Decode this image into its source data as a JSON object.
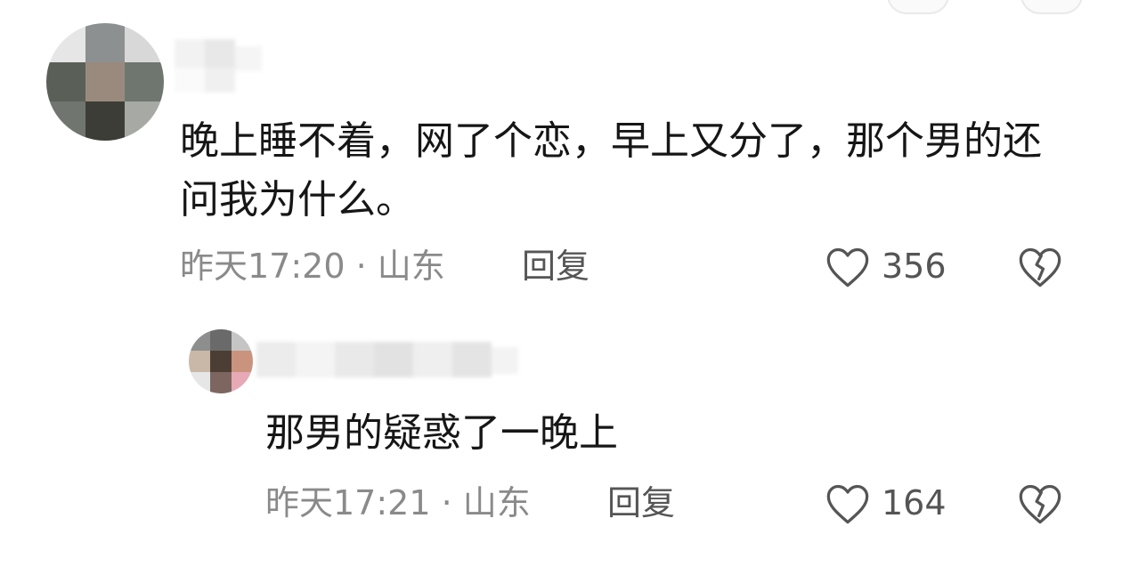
{
  "comments": [
    {
      "text": "晚上睡不着，网了个恋，早上又分了，那个男的还问我为什么。",
      "time": "昨天17:20 · 山东",
      "reply_label": "回复",
      "likes": "356",
      "avatar_icon": "pixelated-avatar",
      "like_icon": "heart-outline-icon",
      "dislike_icon": "broken-heart-icon"
    },
    {
      "text": "那男的疑惑了一晚上",
      "time": "昨天17:21 · 山东",
      "reply_label": "回复",
      "likes": "164",
      "avatar_icon": "pixelated-avatar",
      "like_icon": "heart-outline-icon",
      "dislike_icon": "broken-heart-icon"
    }
  ],
  "colors": {
    "text": "#161616",
    "meta": "#8a8a8a",
    "action": "#555555"
  }
}
